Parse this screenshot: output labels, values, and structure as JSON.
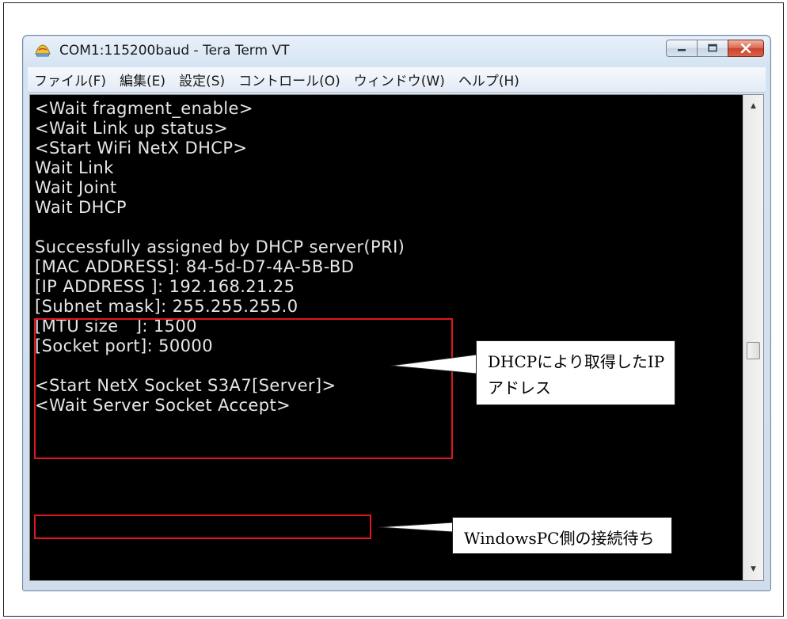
{
  "window": {
    "title": "COM1:115200baud - Tera Term VT"
  },
  "menubar": {
    "items": [
      "ファイル(F)",
      "編集(E)",
      "設定(S)",
      "コントロール(O)",
      "ウィンドウ(W)",
      "ヘルプ(H)"
    ]
  },
  "terminal": {
    "lines": [
      "<Wait fragment_enable>",
      "<Wait Link up status>",
      "<Start WiFi NetX DHCP>",
      "Wait Link",
      "Wait Joint",
      "Wait DHCP",
      "",
      "Successfully assigned by DHCP server(PRI)",
      "[MAC ADDRESS]: 84-5d-D7-4A-5B-BD",
      "[IP ADDRESS ]: 192.168.21.25",
      "[Subnet mask]: 255.255.255.0",
      "[MTU size   ]: 1500",
      "[Socket port]: 50000",
      "",
      "<Start NetX Socket S3A7[Server]>",
      "<Wait Server Socket Accept>"
    ]
  },
  "annotations": {
    "dhcp_callout": {
      "line1": "DHCPにより取得したIP",
      "line2": "アドレス"
    },
    "wait_callout": {
      "text": "WindowsPC側の接続待ち"
    },
    "highlight_color": "#e0161c"
  },
  "colors": {
    "terminal_bg": "#000000",
    "terminal_fg": "#e6e6e6",
    "close_button": "#c9432b"
  }
}
